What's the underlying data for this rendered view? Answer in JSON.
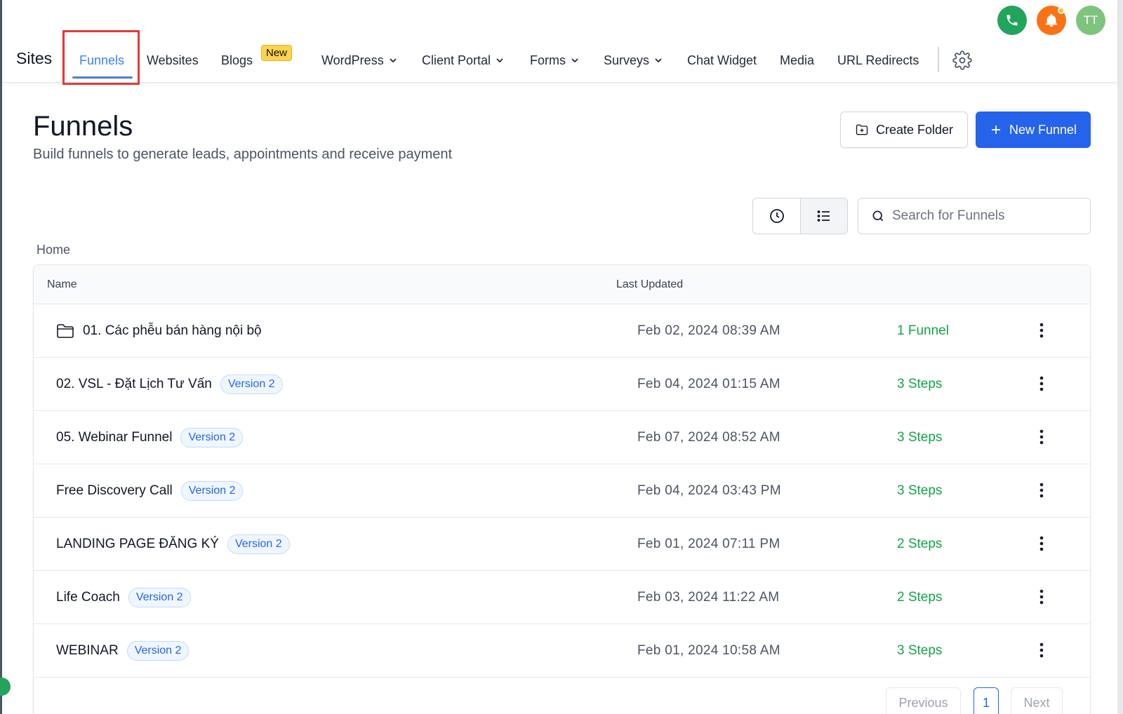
{
  "header": {
    "brand": "Sites",
    "nav": [
      {
        "label": "Funnels",
        "active": true
      },
      {
        "label": "Websites"
      },
      {
        "label": "Blogs",
        "badge": "New"
      },
      {
        "label": "WordPress",
        "dropdown": true
      },
      {
        "label": "Client Portal",
        "dropdown": true
      },
      {
        "label": "Forms",
        "dropdown": true
      },
      {
        "label": "Surveys",
        "dropdown": true
      },
      {
        "label": "Chat Widget"
      },
      {
        "label": "Media"
      },
      {
        "label": "URL Redirects"
      }
    ],
    "avatar_initials": "TT",
    "phone_color": "#22a45d",
    "bell_color": "#f97316",
    "avatar_color": "#7ec47f"
  },
  "page": {
    "title": "Funnels",
    "subtitle": "Build funnels to generate leads, appointments and receive payment",
    "create_folder_label": "Create Folder",
    "new_funnel_label": "New Funnel",
    "search_placeholder": "Search for Funnels",
    "breadcrumb": "Home"
  },
  "table": {
    "columns": {
      "name": "Name",
      "last_updated": "Last Updated"
    },
    "rows": [
      {
        "name": "01. Các phễu bán hàng nội bộ",
        "folder": true,
        "date": "Feb 02, 2024 08:39 AM",
        "count": "1 Funnel"
      },
      {
        "name": "02. VSL - Đặt Lịch Tư Vấn",
        "version": "Version 2",
        "date": "Feb 04, 2024 01:15 AM",
        "count": "3 Steps"
      },
      {
        "name": "05. Webinar Funnel",
        "version": "Version 2",
        "date": "Feb 07, 2024 08:52 AM",
        "count": "3 Steps"
      },
      {
        "name": "Free Discovery Call",
        "version": "Version 2",
        "date": "Feb 04, 2024 03:43 PM",
        "count": "3 Steps"
      },
      {
        "name": "LANDING PAGE ĐĂNG KÝ",
        "version": "Version 2",
        "date": "Feb 01, 2024 07:11 PM",
        "count": "2 Steps"
      },
      {
        "name": "Life Coach",
        "version": "Version 2",
        "date": "Feb 03, 2024 11:22 AM",
        "count": "2 Steps"
      },
      {
        "name": "WEBINAR",
        "version": "Version 2",
        "date": "Feb 01, 2024 10:58 AM",
        "count": "3 Steps"
      }
    ]
  },
  "pagination": {
    "previous": "Previous",
    "current": "1",
    "next": "Next"
  }
}
